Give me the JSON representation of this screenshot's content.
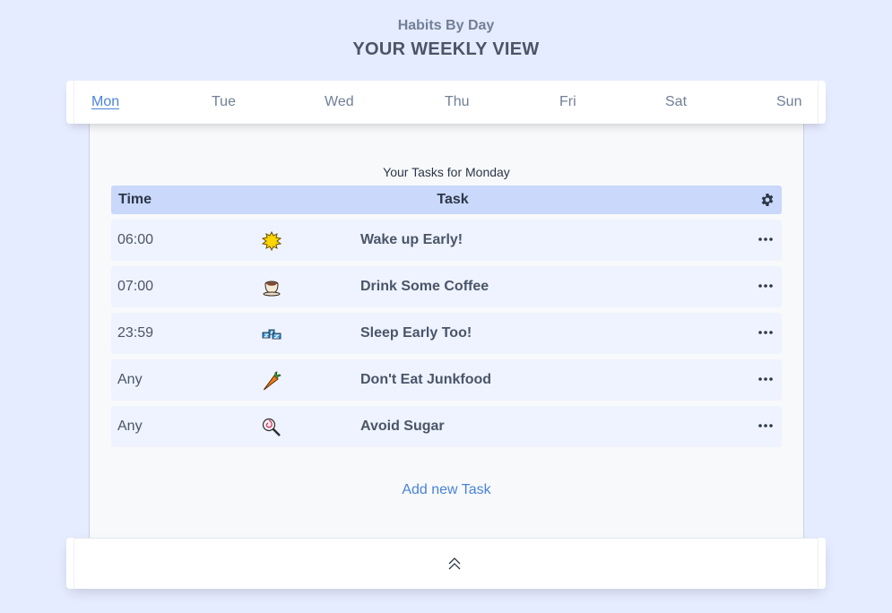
{
  "header": {
    "subtitle": "Habits By Day",
    "title": "YOUR WEEKLY VIEW"
  },
  "tabs": [
    {
      "label": "Mon",
      "active": true
    },
    {
      "label": "Tue",
      "active": false
    },
    {
      "label": "Wed",
      "active": false
    },
    {
      "label": "Thu",
      "active": false
    },
    {
      "label": "Fri",
      "active": false
    },
    {
      "label": "Sat",
      "active": false
    },
    {
      "label": "Sun",
      "active": false
    }
  ],
  "panel": {
    "caption": "Your Tasks for Monday",
    "table": {
      "headers": {
        "time": "Time",
        "task": "Task",
        "settings_icon": "gear-icon"
      },
      "rows": [
        {
          "time": "06:00",
          "icon": "sun-icon",
          "task": "Wake up Early!"
        },
        {
          "time": "07:00",
          "icon": "coffee-icon",
          "task": "Drink Some Coffee"
        },
        {
          "time": "23:59",
          "icon": "sleep-icon",
          "task": "Sleep Early Too!"
        },
        {
          "time": "Any",
          "icon": "carrot-icon",
          "task": "Don't Eat Junkfood"
        },
        {
          "time": "Any",
          "icon": "lollipop-icon",
          "task": "Avoid Sugar"
        }
      ]
    },
    "add_label": "Add new Task"
  },
  "footer": {
    "collapse_icon": "double-chevron-up-icon"
  },
  "colors": {
    "background": "#e6ecff",
    "accent": "#4a83d9",
    "table_header": "#c9d8fb",
    "row_background": "#eef3ff"
  }
}
